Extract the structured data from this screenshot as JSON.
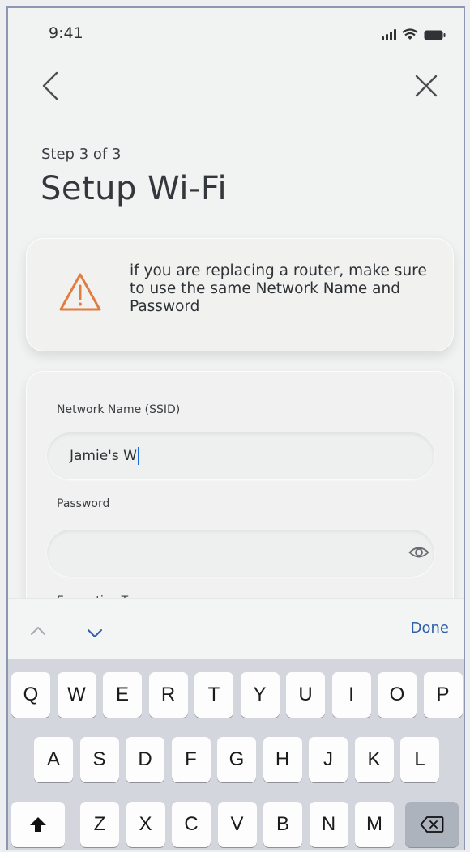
{
  "status_bar": {
    "time": "9:41"
  },
  "header": {
    "step": "Step 3 of 3",
    "title": "Setup Wi-Fi"
  },
  "warning": {
    "icon": "warning-triangle-icon",
    "icon_color": "#e27d3f",
    "message": "if you are replacing a router, make sure to use the same Network Name and Password"
  },
  "form": {
    "ssid_label": "Network Name (SSID)",
    "ssid_value": "Jamie's W",
    "password_label": "Password",
    "password_value": "",
    "partial_next_label": "Encryption Type"
  },
  "accessory": {
    "done_label": "Done",
    "accent_color": "#2f5fa8"
  },
  "keyboard": {
    "row1": [
      "Q",
      "W",
      "E",
      "R",
      "T",
      "Y",
      "U",
      "I",
      "O",
      "P"
    ],
    "row2": [
      "A",
      "S",
      "D",
      "F",
      "G",
      "H",
      "J",
      "K",
      "L"
    ],
    "row3": [
      "Z",
      "X",
      "C",
      "V",
      "B",
      "N",
      "M"
    ],
    "shift_icon": "shift-arrow-icon",
    "delete_icon": "backspace-icon"
  }
}
